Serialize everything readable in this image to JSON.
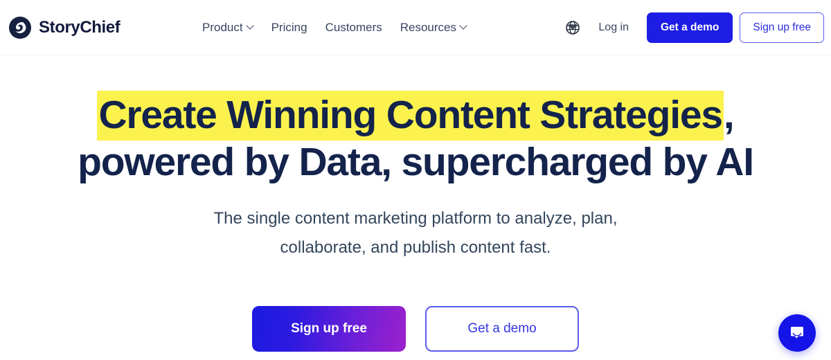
{
  "brand": {
    "name": "StoryChief",
    "logo_icon": "storychief-logo-icon"
  },
  "nav": {
    "items": [
      {
        "label": "Product",
        "has_chevron": true
      },
      {
        "label": "Pricing",
        "has_chevron": false
      },
      {
        "label": "Customers",
        "has_chevron": false
      },
      {
        "label": "Resources",
        "has_chevron": true
      }
    ]
  },
  "header_actions": {
    "language_icon": "globe-icon",
    "login_label": "Log in",
    "demo_label": "Get a demo",
    "signup_label": "Sign up free"
  },
  "hero": {
    "headline_line1_highlighted": "Create Winning Content Strategies",
    "headline_line1_tail": ",",
    "headline_line2": "powered by Data, supercharged by AI",
    "subhead_line1": "The single content marketing platform to analyze, plan,",
    "subhead_line2": "collaborate, and publish content fast.",
    "cta_primary": "Sign up free",
    "cta_secondary": "Get a demo"
  },
  "chat": {
    "icon": "chat-bubble-icon"
  },
  "colors": {
    "brand_navy": "#13234b",
    "accent_blue": "#1d1de6",
    "highlight_yellow": "#fbf24e",
    "gradient_start": "#1a1ae0",
    "gradient_end": "#9d21cc",
    "subhead_gray": "#33465c",
    "chat_blue": "#1414e8"
  }
}
